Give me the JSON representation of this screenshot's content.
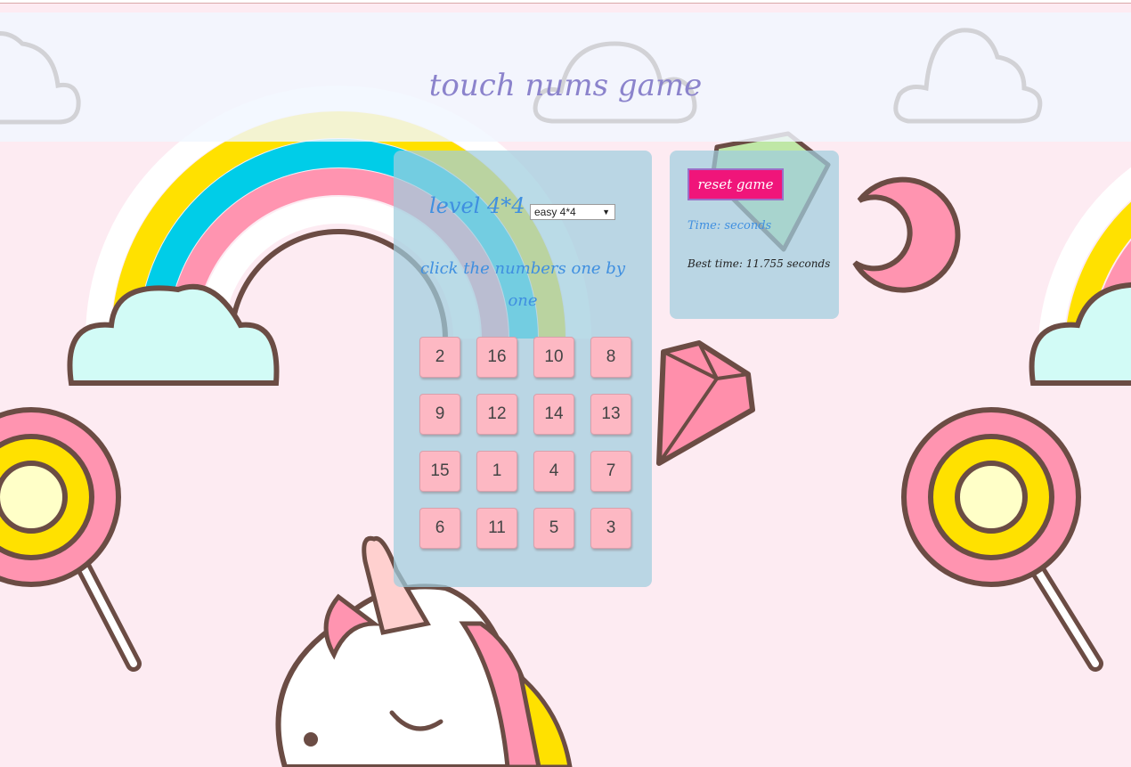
{
  "header": {
    "title": "touch nums game"
  },
  "game": {
    "level_title": "level 4*4",
    "level_select": {
      "selected": "easy 4*4"
    },
    "instruction": "click the numbers one by one",
    "tiles": [
      "2",
      "16",
      "10",
      "8",
      "9",
      "12",
      "14",
      "13",
      "15",
      "1",
      "4",
      "7",
      "6",
      "11",
      "5",
      "3"
    ]
  },
  "info": {
    "reset_label": "reset game",
    "time_label": "Time: seconds",
    "best_time": "Best time: 11.755 seconds"
  },
  "colors": {
    "background": "#fdebf2",
    "panel": "#a0cdde",
    "tile": "#fdb8c3",
    "reset_button": "#f0157a",
    "accent_text": "#3f8fe0",
    "title_text": "#8b83cc"
  }
}
